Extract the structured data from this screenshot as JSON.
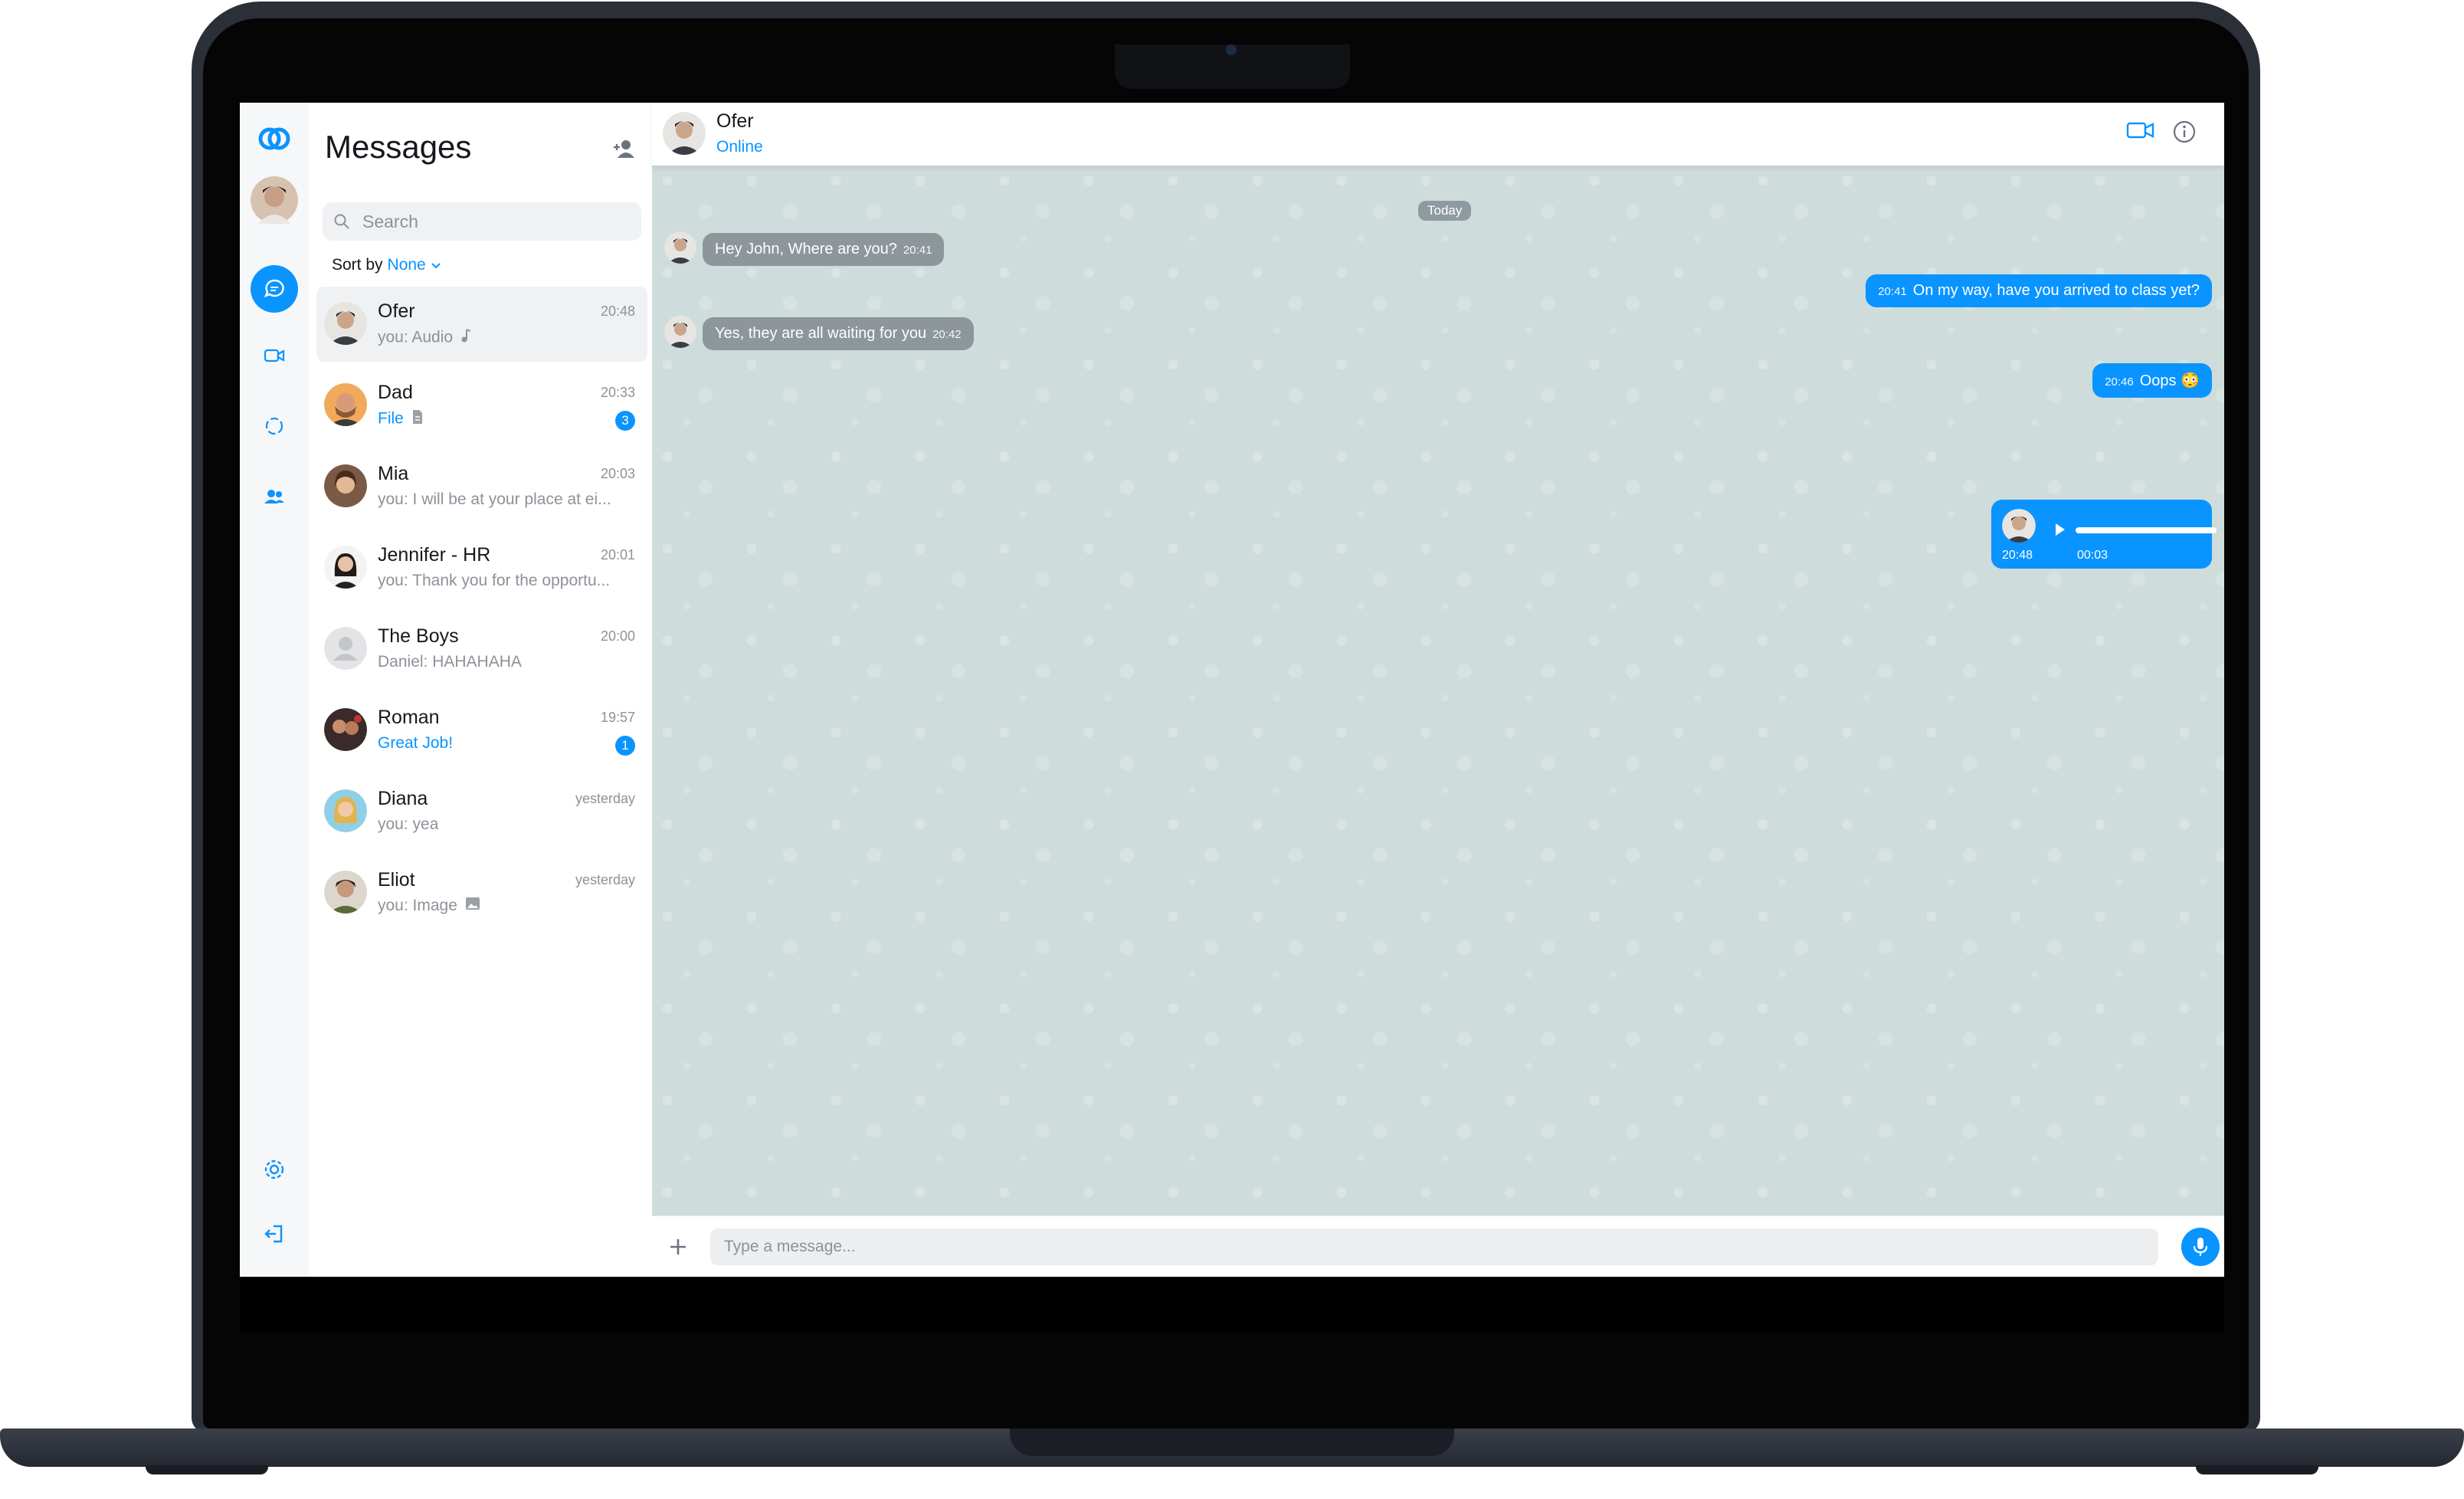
{
  "nav": {
    "icons": [
      "app-logo",
      "chats-icon",
      "video-icon",
      "status-icon",
      "contacts-icon",
      "settings-icon",
      "logout-icon"
    ]
  },
  "list": {
    "title": "Messages",
    "search_placeholder": "Search",
    "sort_label": "Sort by",
    "sort_value": "None",
    "conversations": [
      {
        "name": "Ofer",
        "time": "20:48",
        "preview": "you: Audio",
        "preview_icon": "music-note-icon",
        "unread": ""
      },
      {
        "name": "Dad",
        "time": "20:33",
        "preview": "File",
        "preview_icon": "file-icon",
        "unread": "3"
      },
      {
        "name": "Mia",
        "time": "20:03",
        "preview": "you: I will be at your place at ei...",
        "preview_icon": "",
        "unread": ""
      },
      {
        "name": "Jennifer - HR",
        "time": "20:01",
        "preview": "you: Thank you for the opportu...",
        "preview_icon": "",
        "unread": ""
      },
      {
        "name": "The Boys",
        "time": "20:00",
        "preview": "Daniel: HAHAHAHA",
        "preview_icon": "",
        "unread": ""
      },
      {
        "name": "Roman",
        "time": "19:57",
        "preview": "Great Job!",
        "preview_icon": "",
        "unread": "1"
      },
      {
        "name": "Diana",
        "time": "yesterday",
        "preview": "you: yea",
        "preview_icon": "",
        "unread": ""
      },
      {
        "name": "Eliot",
        "time": "yesterday",
        "preview": "you: Image",
        "preview_icon": "image-icon",
        "unread": ""
      }
    ]
  },
  "chat": {
    "contact_name": "Ofer",
    "contact_status": "Online",
    "day_divider": "Today",
    "messages": [
      {
        "direction": "in",
        "text": "Hey John, Where are you?",
        "time": "20:41"
      },
      {
        "direction": "out",
        "text": "On my way, have you arrived to class yet?",
        "time": "20:41"
      },
      {
        "direction": "in",
        "text": "Yes, they are all waiting for you",
        "time": "20:42"
      },
      {
        "direction": "out",
        "text": "Oops 😳",
        "time": "20:46"
      },
      {
        "direction": "out",
        "type": "audio",
        "time": "20:48",
        "duration": "00:03"
      }
    ],
    "composer_placeholder": "Type a message..."
  },
  "colors": {
    "accent": "#0a94ff",
    "incoming_bubble": "#8c969b",
    "chat_background": "#cfdcdc"
  }
}
